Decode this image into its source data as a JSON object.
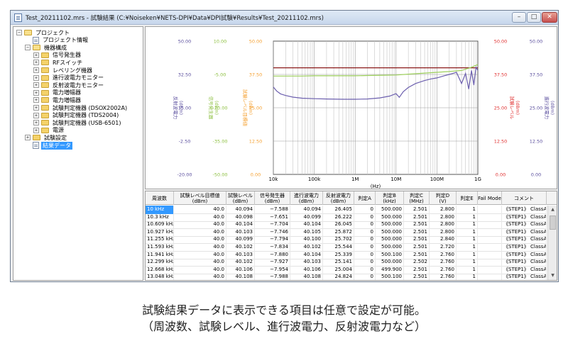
{
  "window": {
    "title": "Test_20211102.mrs - 試験結果 (C:¥Noiseken¥NETS-DPI¥Data¥DPI試験¥Results¥Test_20211102.mrs)",
    "minimize": "–",
    "maximize": "□",
    "close": "✕"
  },
  "tree": {
    "items": [
      {
        "label": "プロジェクト",
        "level": 0,
        "exp": "−",
        "icon": "folder-open"
      },
      {
        "label": "プロジェクト情報",
        "level": 1,
        "exp": "",
        "icon": "document"
      },
      {
        "label": "機器構成",
        "level": 1,
        "exp": "−",
        "icon": "folder-open"
      },
      {
        "label": "信号発生器",
        "level": 2,
        "exp": "+",
        "icon": "folder"
      },
      {
        "label": "RFスイッチ",
        "level": 2,
        "exp": "+",
        "icon": "folder"
      },
      {
        "label": "レベリング機器",
        "level": 2,
        "exp": "+",
        "icon": "folder"
      },
      {
        "label": "進行波電力モニター",
        "level": 2,
        "exp": "+",
        "icon": "folder"
      },
      {
        "label": "反射波電力モニター",
        "level": 2,
        "exp": "+",
        "icon": "folder"
      },
      {
        "label": "電力増幅器",
        "level": 2,
        "exp": "+",
        "icon": "folder"
      },
      {
        "label": "電力増幅器",
        "level": 2,
        "exp": "+",
        "icon": "folder"
      },
      {
        "label": "試験判定機器 (DSOX2002A)",
        "level": 2,
        "exp": "+",
        "icon": "folder"
      },
      {
        "label": "試験判定機器 (TDS2004)",
        "level": 2,
        "exp": "+",
        "icon": "folder"
      },
      {
        "label": "試験判定機器 (USB-6501)",
        "level": 2,
        "exp": "+",
        "icon": "folder"
      },
      {
        "label": "電源",
        "level": 2,
        "exp": "+",
        "icon": "folder"
      },
      {
        "label": "試験設定",
        "level": 1,
        "exp": "+",
        "icon": "folder"
      },
      {
        "label": "結果データ",
        "level": 1,
        "exp": "",
        "icon": "document",
        "selected": true
      }
    ]
  },
  "chart_data": {
    "type": "line",
    "x_scale": "log",
    "xlim": [
      10000,
      1000000000
    ],
    "xlabel": "(Hz)",
    "x_ticks": [
      {
        "value": 10000,
        "label": "10k"
      },
      {
        "value": 100000,
        "label": "100k"
      },
      {
        "value": 1000000,
        "label": "1M"
      },
      {
        "value": 10000000,
        "label": "10M"
      },
      {
        "value": 100000000,
        "label": "100M"
      },
      {
        "value": 1000000000,
        "label": "1G"
      }
    ],
    "axes": [
      {
        "label": "反射波電力\n(dBm)",
        "color": "#5b4f9e",
        "side": "left",
        "ticks": [
          "50.00",
          "32.50",
          "15.00",
          "-2.50",
          "-20.00"
        ]
      },
      {
        "label": "信号発生器\n(dBm)",
        "color": "#8cbf3f",
        "side": "left",
        "ticks": [
          "10.00",
          "-5.00",
          "-20.00",
          "-35.00",
          "-50.00"
        ]
      },
      {
        "label": "試験レベル目標値\n(dBm)",
        "color": "#f5a030",
        "side": "left",
        "ticks": [
          "50.00",
          "37.50",
          "25.00",
          "12.50",
          "0.00"
        ]
      },
      {
        "label": "試験レベル\n(dBm)",
        "color": "#e03030",
        "side": "right",
        "ticks": [
          "50.00",
          "37.50",
          "25.00",
          "12.50",
          "0.00"
        ]
      },
      {
        "label": "進行波電力\n(dBm)",
        "color": "#5b4f9e",
        "side": "right",
        "ticks": [
          "50.00",
          "37.50",
          "25.00",
          "12.50",
          "0.00"
        ]
      }
    ],
    "ylim": [
      0,
      50
    ],
    "series": [
      {
        "name": "試験レベル",
        "color": "#8b1a1a",
        "x": [
          10000,
          1000000000
        ],
        "y": [
          40,
          40
        ]
      },
      {
        "name": "信号発生器",
        "color": "#9ccf5a",
        "x": [
          10000,
          20000,
          50000,
          100000,
          200000,
          500000,
          1000000,
          2000000,
          5000000,
          10000000,
          20000000,
          50000000,
          100000000,
          200000000,
          400000000,
          700000000,
          1000000000
        ],
        "y": [
          36.9,
          36.9,
          36.9,
          37.0,
          37.0,
          37.0,
          37.0,
          37.1,
          37.2,
          37.3,
          37.6,
          38.0,
          38.3,
          38.6,
          39.0,
          40.2,
          41.2
        ]
      },
      {
        "name": "進行波電力",
        "color": "#6c5fae",
        "x": [
          10000,
          12000,
          15000,
          20000,
          30000,
          50000,
          100000,
          200000,
          500000,
          1000000,
          2000000,
          4000000,
          7000000,
          10000000,
          12000000,
          15000000,
          20000000,
          30000000,
          50000000,
          70000000,
          100000000,
          150000000,
          200000000,
          300000000,
          400000000,
          500000000,
          600000000,
          700000000,
          800000000,
          900000000,
          1000000000
        ],
        "y": [
          32.8,
          31.3,
          30.2,
          29.6,
          29.0,
          28.6,
          28.4,
          28.3,
          28.2,
          28.2,
          28.3,
          28.7,
          29.4,
          30.3,
          28.9,
          31.0,
          32.6,
          34.1,
          35.2,
          35.8,
          36.2,
          37.0,
          37.5,
          38.3,
          34.1,
          37.9,
          32.0,
          39.0,
          33.5,
          40.2,
          39.0
        ]
      }
    ]
  },
  "table": {
    "columns": [
      "周波数",
      "試験レベル目標値\n(dBm)",
      "試験レベル\n(dBm)",
      "信号発生器\n(dBm)",
      "進行波電力\n(dBm)",
      "反射波電力\n(dBm)",
      "判定A",
      "判定B\n(kHz)",
      "判定C\n(MHz)",
      "判定D\n(V)",
      "判定E",
      "Fail Mode",
      "コメント"
    ],
    "rows": [
      [
        "10 kHz",
        "40.0",
        "40.094",
        "−7.588",
        "40.094",
        "26.405",
        "0",
        "500.000",
        "2.501",
        "2.800",
        "1",
        "",
        "《STEP1》 ClassA"
      ],
      [
        "10.3 kHz",
        "40.0",
        "40.098",
        "−7.651",
        "40.099",
        "26.222",
        "0",
        "500.000",
        "2.501",
        "2.800",
        "1",
        "",
        "《STEP1》 ClassA"
      ],
      [
        "10.609 kHz",
        "40.0",
        "40.104",
        "−7.704",
        "40.104",
        "26.045",
        "0",
        "500.000",
        "2.501",
        "2.800",
        "1",
        "",
        "《STEP1》 ClassA"
      ],
      [
        "10.927 kHz",
        "40.0",
        "40.103",
        "−7.746",
        "40.105",
        "25.872",
        "0",
        "500.000",
        "2.501",
        "2.800",
        "1",
        "",
        "《STEP1》 ClassA"
      ],
      [
        "11.255 kHz",
        "40.0",
        "40.099",
        "−7.794",
        "40.100",
        "25.702",
        "0",
        "500.000",
        "2.501",
        "2.840",
        "1",
        "",
        "《STEP1》 ClassA"
      ],
      [
        "11.593 kHz",
        "40.0",
        "40.102",
        "−7.834",
        "40.102",
        "25.544",
        "0",
        "500.000",
        "2.501",
        "2.720",
        "1",
        "",
        "《STEP1》 ClassA"
      ],
      [
        "11.941 kHz",
        "40.0",
        "40.103",
        "−7.880",
        "40.104",
        "25.339",
        "0",
        "500.100",
        "2.501",
        "2.760",
        "1",
        "",
        "《STEP1》 ClassA"
      ],
      [
        "12.299 kHz",
        "40.0",
        "40.102",
        "−7.927",
        "40.103",
        "25.141",
        "0",
        "500.000",
        "2.502",
        "2.760",
        "1",
        "",
        "《STEP1》 ClassA"
      ],
      [
        "12.668 kHz",
        "40.0",
        "40.106",
        "−7.954",
        "40.106",
        "25.004",
        "0",
        "499.900",
        "2.501",
        "2.760",
        "1",
        "",
        "《STEP1》 ClassA"
      ],
      [
        "13.048 kHz",
        "40.0",
        "40.108",
        "−7.988",
        "40.108",
        "24.824",
        "0",
        "500.100",
        "2.501",
        "2.760",
        "1",
        "",
        "《STEP1》 ClassA"
      ]
    ]
  },
  "caption": {
    "line1": "試験結果データに表示できる項目は任意で設定が可能。",
    "line2": "（周波数、試験レベル、進行波電力、反射波電力など）"
  }
}
